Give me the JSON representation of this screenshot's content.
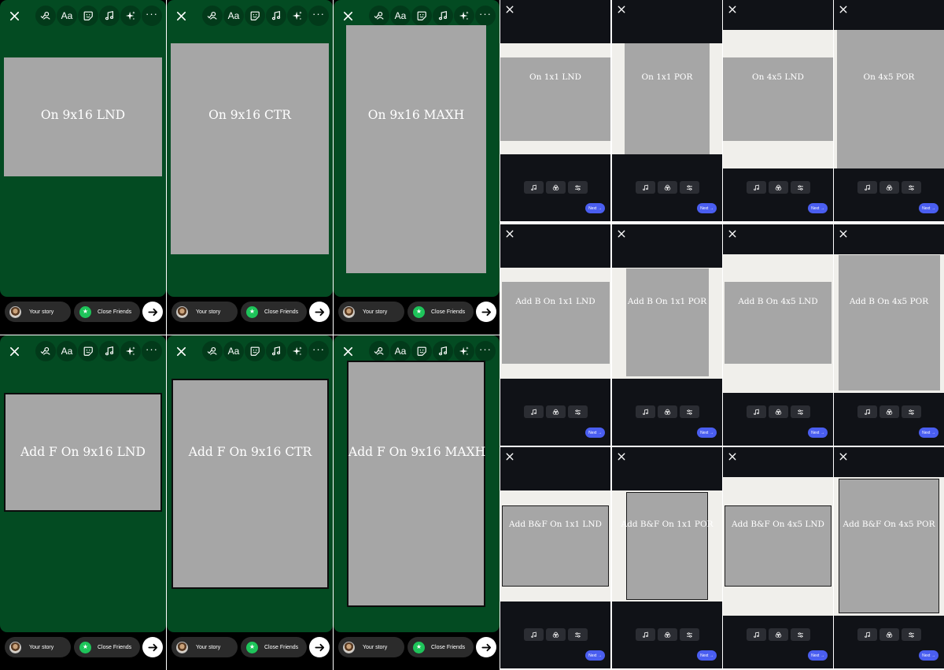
{
  "toolbar_icons": [
    "close-icon",
    "tag-people-icon",
    "text-icon",
    "sticker-icon",
    "music-icon",
    "effects-icon",
    "more-icon"
  ],
  "toolbar_text_label": "Aa",
  "toolbar_more_label": "···",
  "share_bar": {
    "your_story": "Your story",
    "close_friends": "Close Friends",
    "close_friends_badge": "★"
  },
  "story_panels": [
    {
      "label": "On 9x16 LND"
    },
    {
      "label": "On 9x16 CTR"
    },
    {
      "label": "On 9x16 MAXH"
    },
    {
      "label": "Add F On 9x16 LND"
    },
    {
      "label": "Add F On 9x16 CTR"
    },
    {
      "label": "Add F On 9x16 MAXH"
    }
  ],
  "ratio_cells": [
    {
      "label": "On 1x1 LND"
    },
    {
      "label": "On 1x1 POR"
    },
    {
      "label": "On 4x5 LND"
    },
    {
      "label": "On 4x5 POR"
    },
    {
      "label": "Add B On 1x1 LND"
    },
    {
      "label": "Add B On 1x1 POR"
    },
    {
      "label": "Add B On 4x5 LND"
    },
    {
      "label": "Add B On 4x5 POR"
    },
    {
      "label": "Add B&F On 1x1 LND"
    },
    {
      "label": "Add B&F On 1x1 POR"
    },
    {
      "label": "Add B&F On 4x5 LND"
    },
    {
      "label": "Add B&F On 4x5 POR"
    }
  ],
  "editor_tools": [
    "music-icon",
    "effects-icon",
    "adjust-icon"
  ],
  "next_label": "Next →",
  "colors": {
    "story_background": "#034b22",
    "placeholder_gray": "#a6a6a6",
    "frame_white": "#f0efeb",
    "editor_dark": "#101217",
    "next_button": "#4a5ef0",
    "close_friends_green": "#1ec45a"
  }
}
